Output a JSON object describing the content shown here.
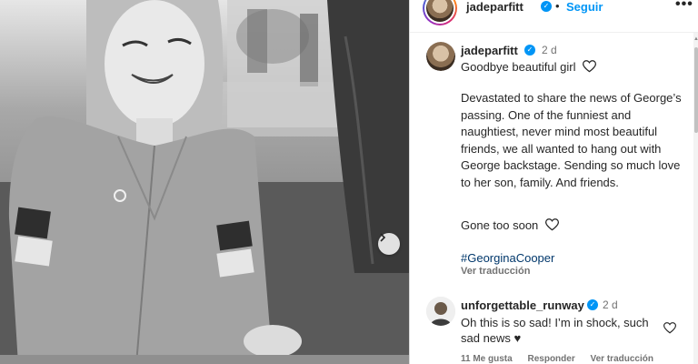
{
  "post": {
    "username": "jadeparfitt",
    "separator": "•",
    "follow_label": "Seguir",
    "more_label": "•••"
  },
  "caption": {
    "username": "jadeparfitt",
    "time": "2 d",
    "line1": "Goodbye beautiful girl",
    "body": "Devastated to share the news of George’s passing. One of the funniest and naughtiest, never mind most beautiful friends, we all wanted to hang out with George backstage. Sending so much love to her son, family. And friends.",
    "gone": "Gone too soon",
    "hashtag": "#GeorginaCooper",
    "translate": "Ver traducción"
  },
  "comment": {
    "username": "unforgettable_runway",
    "time": "2 d",
    "text": "Oh this is so sad! I’m in shock, such sad news ♥",
    "likes": "11 Me gusta",
    "reply": "Responder",
    "translate": "Ver traducción"
  },
  "icons": {
    "verified": "✓",
    "next": "›",
    "scroll_up": "▲"
  },
  "colors": {
    "accent": "#0095f6",
    "hashtag": "#00376b",
    "muted": "#737373"
  }
}
